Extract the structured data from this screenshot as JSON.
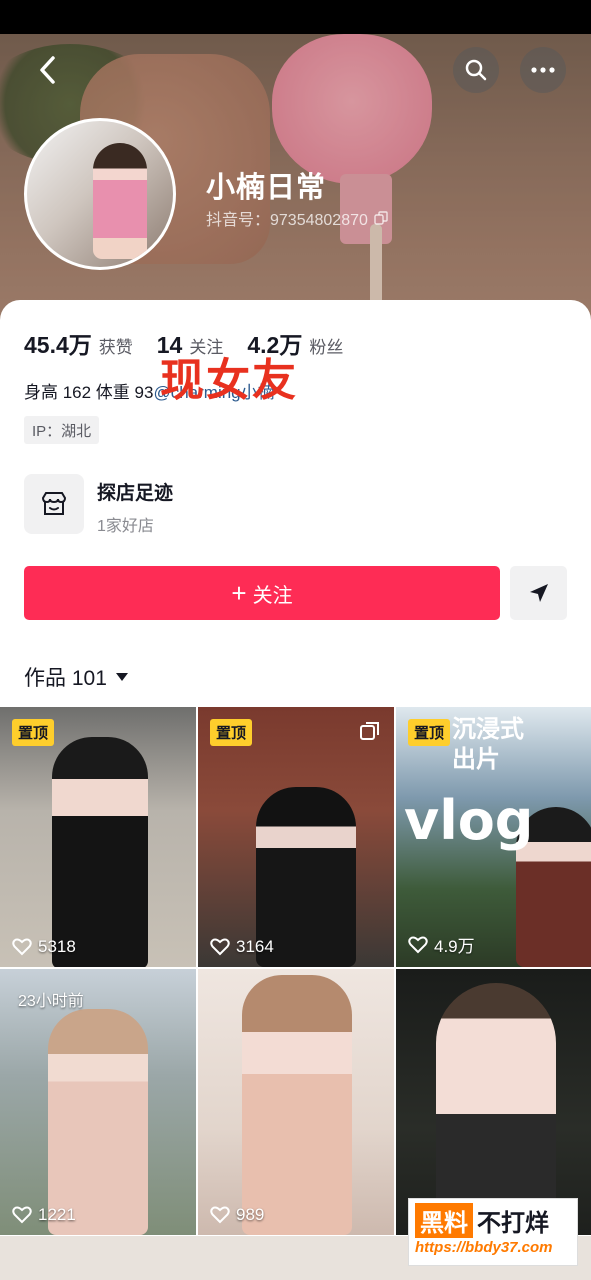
{
  "profile": {
    "nickname": "小楠日常",
    "douyin_id": "抖音号：97354802870",
    "stats": [
      {
        "value": "45.4万",
        "label": "获赞"
      },
      {
        "value": "14",
        "label": "关注"
      },
      {
        "value": "4.2万",
        "label": "粉丝"
      }
    ],
    "bio_prefix": "身高 162 体重 93",
    "bio_link": "@charming小楠",
    "overlay_text": "现女友",
    "ip": "IP：湖北"
  },
  "shop": {
    "title": "探店足迹",
    "subtitle": "1家好店"
  },
  "actions": {
    "follow_label": "关注",
    "follow_plus": "+"
  },
  "works": {
    "tab_label": "作品 101"
  },
  "videos": [
    {
      "pin": "置顶",
      "likes": "5318"
    },
    {
      "pin": "置顶",
      "likes": "3164"
    },
    {
      "pin": "置顶",
      "likes": "4.9万",
      "title_line1": "沉浸式",
      "title_line2": "出片",
      "overlay": "vlog"
    },
    {
      "time": "23小时前",
      "likes": "1221"
    },
    {
      "likes": "989"
    },
    {}
  ],
  "watermark": {
    "brand_a": "黑料",
    "brand_b": "不打烊",
    "url": "https://bbdy37.com"
  },
  "colors": {
    "accent": "#fe2c55",
    "pin": "#fece2c",
    "link": "#2d5b8f",
    "overlay": "#e8311f"
  }
}
